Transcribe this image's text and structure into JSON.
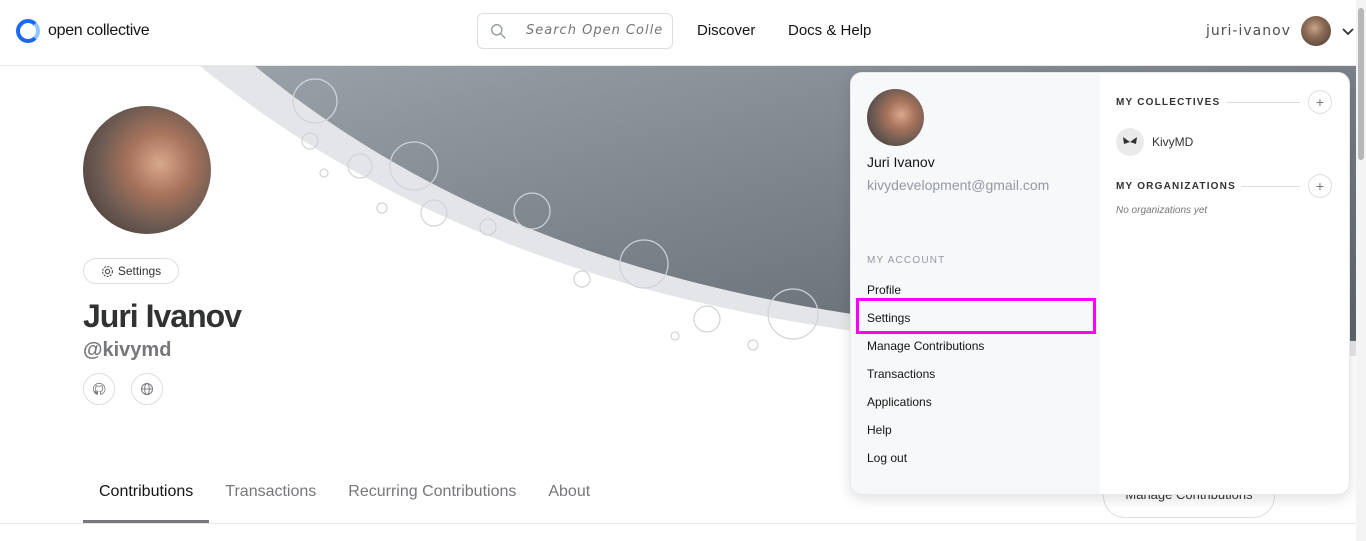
{
  "header": {
    "logo_text": "open collective",
    "search_placeholder": "Search Open Colle",
    "nav": [
      "Discover",
      "Docs & Help"
    ],
    "username": "juri-ivanov"
  },
  "profile": {
    "settings_label": "Settings",
    "name": "Juri Ivanov",
    "handle": "@kivymd",
    "social_icons": [
      "github-icon",
      "globe-icon"
    ]
  },
  "tabs": [
    {
      "label": "Contributions",
      "active": true
    },
    {
      "label": "Transactions",
      "active": false
    },
    {
      "label": "Recurring Contributions",
      "active": false
    },
    {
      "label": "About",
      "active": false
    }
  ],
  "manage_button": "Manage Contributions",
  "dropdown": {
    "name": "Juri Ivanov",
    "email": "kivydevelopment@gmail.com",
    "section_label": "MY ACCOUNT",
    "menu": [
      "Profile",
      "Settings",
      "Manage Contributions",
      "Transactions",
      "Applications",
      "Help",
      "Log out"
    ],
    "highlighted_item": "Settings",
    "collectives_header": "MY COLLECTIVES",
    "collectives": [
      {
        "name": "KivyMD"
      }
    ],
    "organizations_header": "MY ORGANIZATIONS",
    "no_organizations": "No organizations yet"
  },
  "colors": {
    "brand": "#1869f5",
    "highlight": "#ff00ff",
    "hero_gray": "#6e747c"
  }
}
